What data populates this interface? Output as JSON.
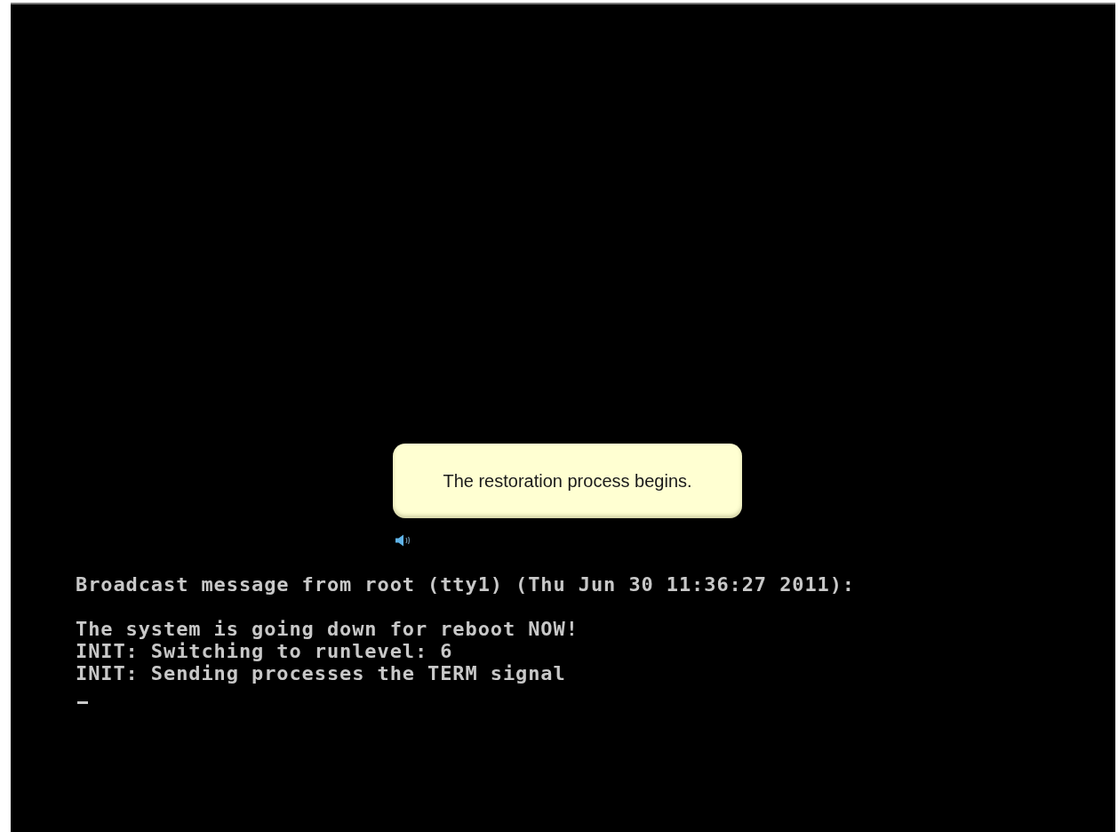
{
  "callout": {
    "text": "The restoration process begins.",
    "audio": true
  },
  "console": {
    "header": "Broadcast message from root (tty1) (Thu Jun 30 11:36:27 2011):",
    "lines": [
      "The system is going down for reboot NOW!",
      "INIT: Switching to runlevel: 6",
      "INIT: Sending processes the TERM signal"
    ],
    "cursor": true
  }
}
